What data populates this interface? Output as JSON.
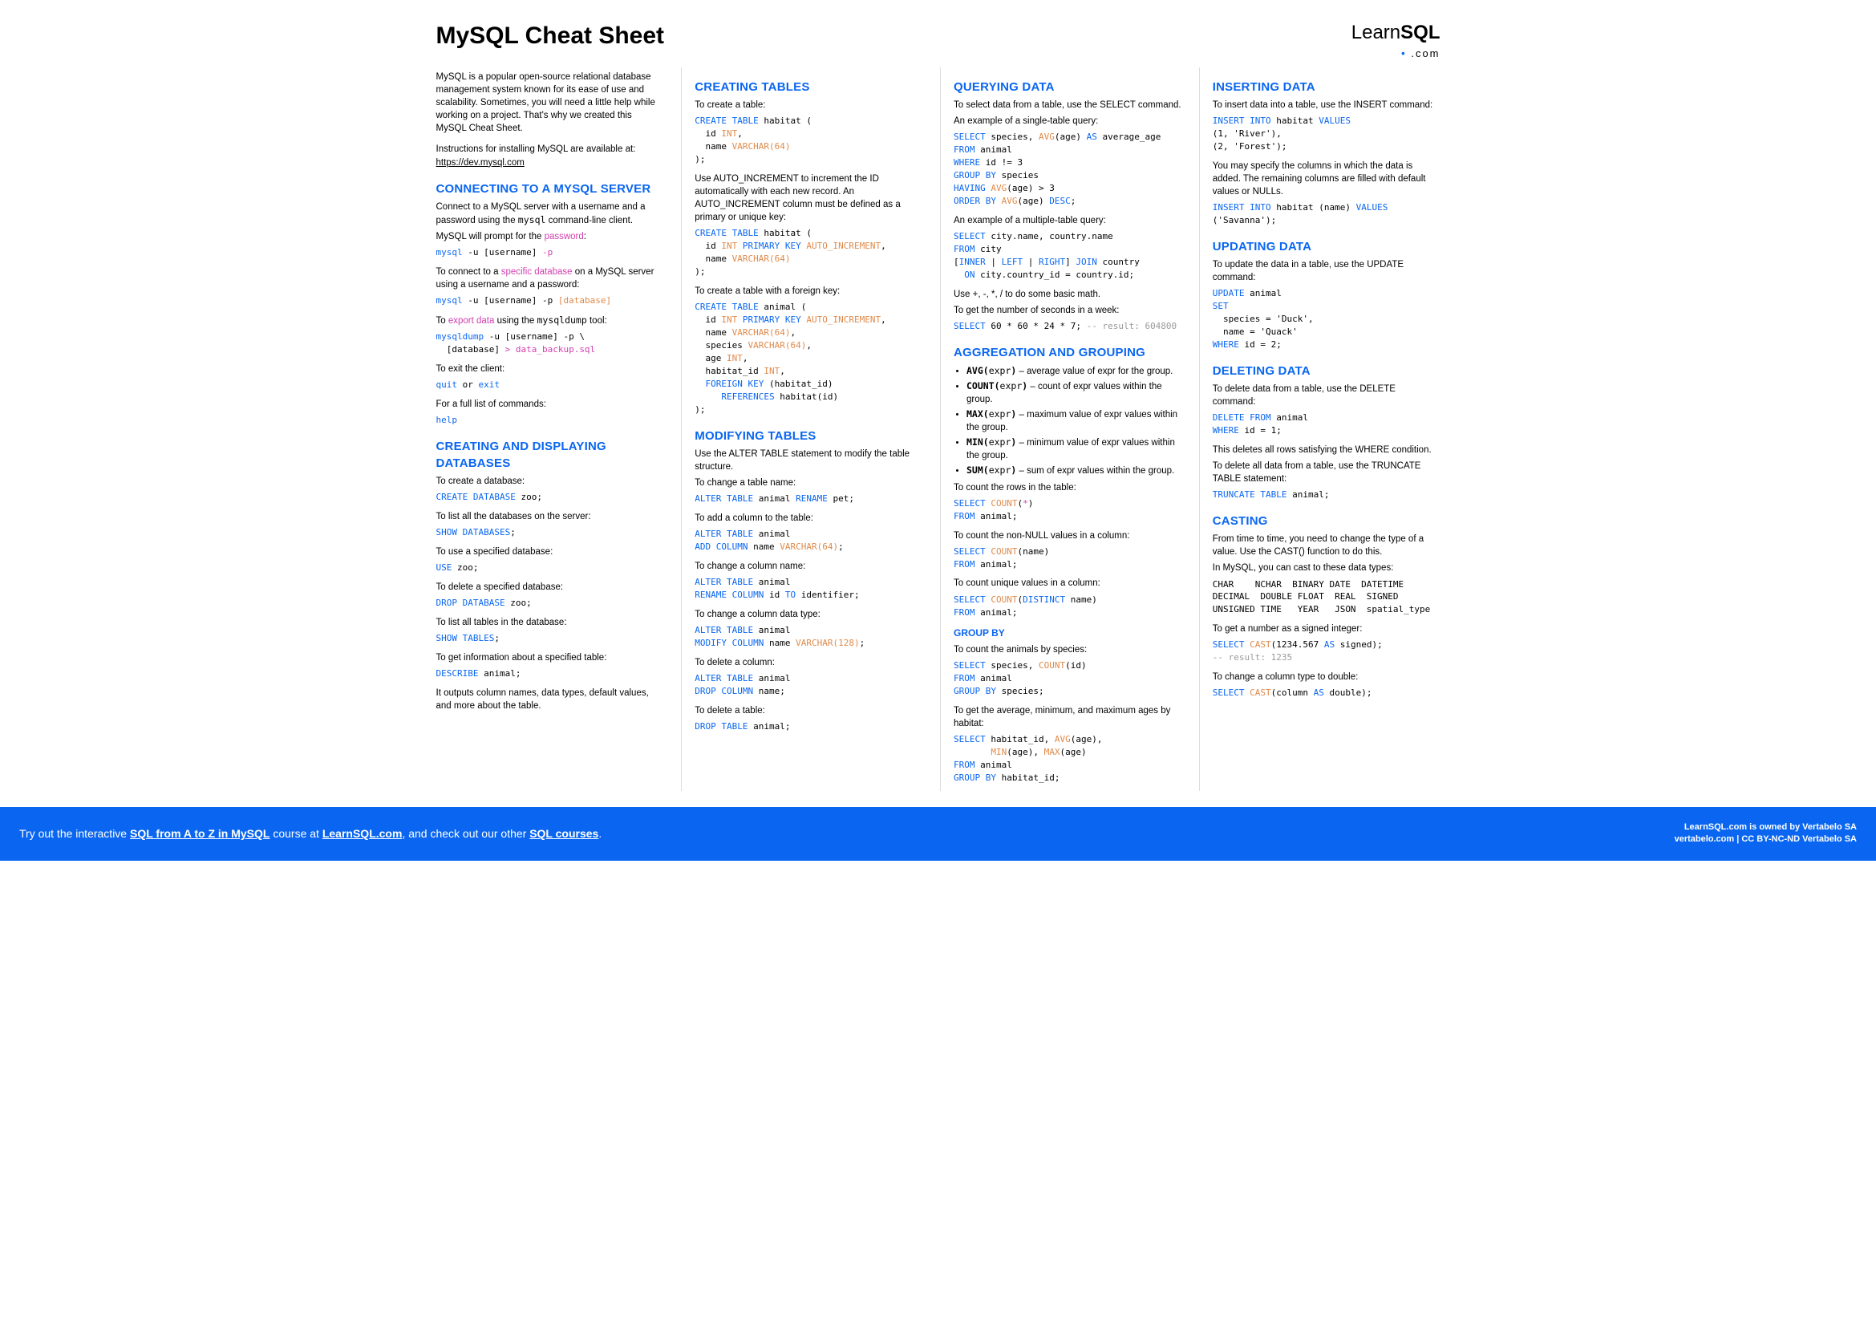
{
  "title": "MySQL Cheat Sheet",
  "logo": {
    "brand1": "Learn",
    "brand2": "SQL",
    "sub": ".com"
  },
  "intro": {
    "p1": "MySQL is a popular open-source relational database management system known for its ease of use and scalability. Sometimes, you will need a little help while working on a project. That's why we created this MySQL Cheat Sheet.",
    "p2": "Instructions for installing MySQL are available at:",
    "url": "https://dev.mysql.com"
  },
  "connect": {
    "h": "CONNECTING TO A MYSQL SERVER",
    "p1a": "Connect to a MySQL server with a username and a password using the ",
    "p1b": " command-line client.",
    "p1cmd": "mysql",
    "p2a": "MySQL will prompt for the ",
    "p2b": ":",
    "p2pw": "password",
    "p3a": "To connect to a ",
    "p3b": " on a MySQL server using a username and a password:",
    "p3db": "specific database",
    "p4a": "To ",
    "p4b": " using the ",
    "p4c": " tool:",
    "p4exp": "export data",
    "p4tool": "mysqldump",
    "p5": "To exit the client:",
    "p6": "For a full list of commands:"
  },
  "dbs": {
    "h": "CREATING AND DISPLAYING DATABASES",
    "p1": "To create a database:",
    "p2": "To list all the databases on the server:",
    "p3": "To use a specified database:",
    "p4": "To delete a specified database:",
    "p5": "To list all tables in the database:",
    "p6": "To get information about a specified table:",
    "p7": "It outputs column names, data types, default values, and more about the table."
  },
  "createT": {
    "h": "CREATING TABLES",
    "p1": "To create a table:",
    "p2": "Use AUTO_INCREMENT to increment the ID automatically with each new record. An AUTO_INCREMENT column must be defined as a primary or unique key:",
    "p3": "To create a table with a foreign key:"
  },
  "modT": {
    "h": "MODIFYING TABLES",
    "p0": "Use the ALTER TABLE statement to modify the table structure.",
    "p1": "To change a table name:",
    "p2": "To add a column to the table:",
    "p3": "To change a column name:",
    "p4": "To change a column data type:",
    "p5": "To delete a column:",
    "p6": "To delete a table:"
  },
  "query": {
    "h": "QUERYING DATA",
    "p1": "To select data from a table, use the SELECT command.",
    "p2": "An example of a single-table query:",
    "p3": "An example of a multiple-table query:",
    "p4": "Use +, -, *, / to do some basic math.",
    "p5": "To get the number of seconds in a week:"
  },
  "agg": {
    "h": "AGGREGATION AND GROUPING",
    "b1a": "AVG(",
    "b1b": "expr",
    "b1c": ")",
    "b1d": " – average value of expr for the group.",
    "b2a": "COUNT(",
    "b2b": "expr",
    "b2c": ")",
    "b2d": " – count of expr values within the group.",
    "b3a": "MAX(",
    "b3b": "expr",
    "b3c": ")",
    "b3d": " – maximum value of expr values within the group.",
    "b4a": "MIN(",
    "b4b": "expr",
    "b4c": ")",
    "b4d": " – minimum value of expr values within the group.",
    "b5a": "SUM(",
    "b5b": "expr",
    "b5c": ")",
    "b5d": " – sum of expr values within the group.",
    "p1": "To count the rows in the table:",
    "p2": "To count the non-NULL values in a column:",
    "p3": "To count unique values in a column:"
  },
  "grp": {
    "h": "GROUP BY",
    "p1": "To count the animals by species:",
    "p2": "To get the average, minimum, and maximum ages by habitat:"
  },
  "ins": {
    "h": "INSERTING DATA",
    "p1": "To insert data into a table, use the INSERT command:",
    "p2": "You may specify the columns in which the data is added. The remaining columns are filled with default values or NULLs."
  },
  "upd": {
    "h": "UPDATING DATA",
    "p1": "To update the data in a table, use the UPDATE command:"
  },
  "del": {
    "h": "DELETING DATA",
    "p1": "To delete data from a table, use the DELETE command:",
    "p2": "This deletes all rows satisfying the WHERE condition.",
    "p3": "To delete all data from a table, use the TRUNCATE TABLE statement:"
  },
  "cast": {
    "h": "CASTING",
    "p1": "From time to time, you need to change the type of a value. Use the CAST() function to do this.",
    "p2": "In MySQL, you can cast to these data types:",
    "types": "CHAR    NCHAR  BINARY DATE  DATETIME\nDECIMAL  DOUBLE FLOAT  REAL  SIGNED\nUNSIGNED TIME   YEAR   JSON  spatial_type",
    "p3": "To get a number as a signed integer:",
    "p4": "To change a column type to double:"
  },
  "footer": {
    "a": "Try out the interactive ",
    "b": "SQL from A to Z in MySQL",
    "c": " course at ",
    "d": "LearnSQL.com",
    "e": ", and check out our other ",
    "f": "SQL courses",
    "g": ".",
    "r1": "LearnSQL.com is owned by Vertabelo SA",
    "r2": "vertabelo.com | CC BY-NC-ND Vertabelo SA"
  }
}
